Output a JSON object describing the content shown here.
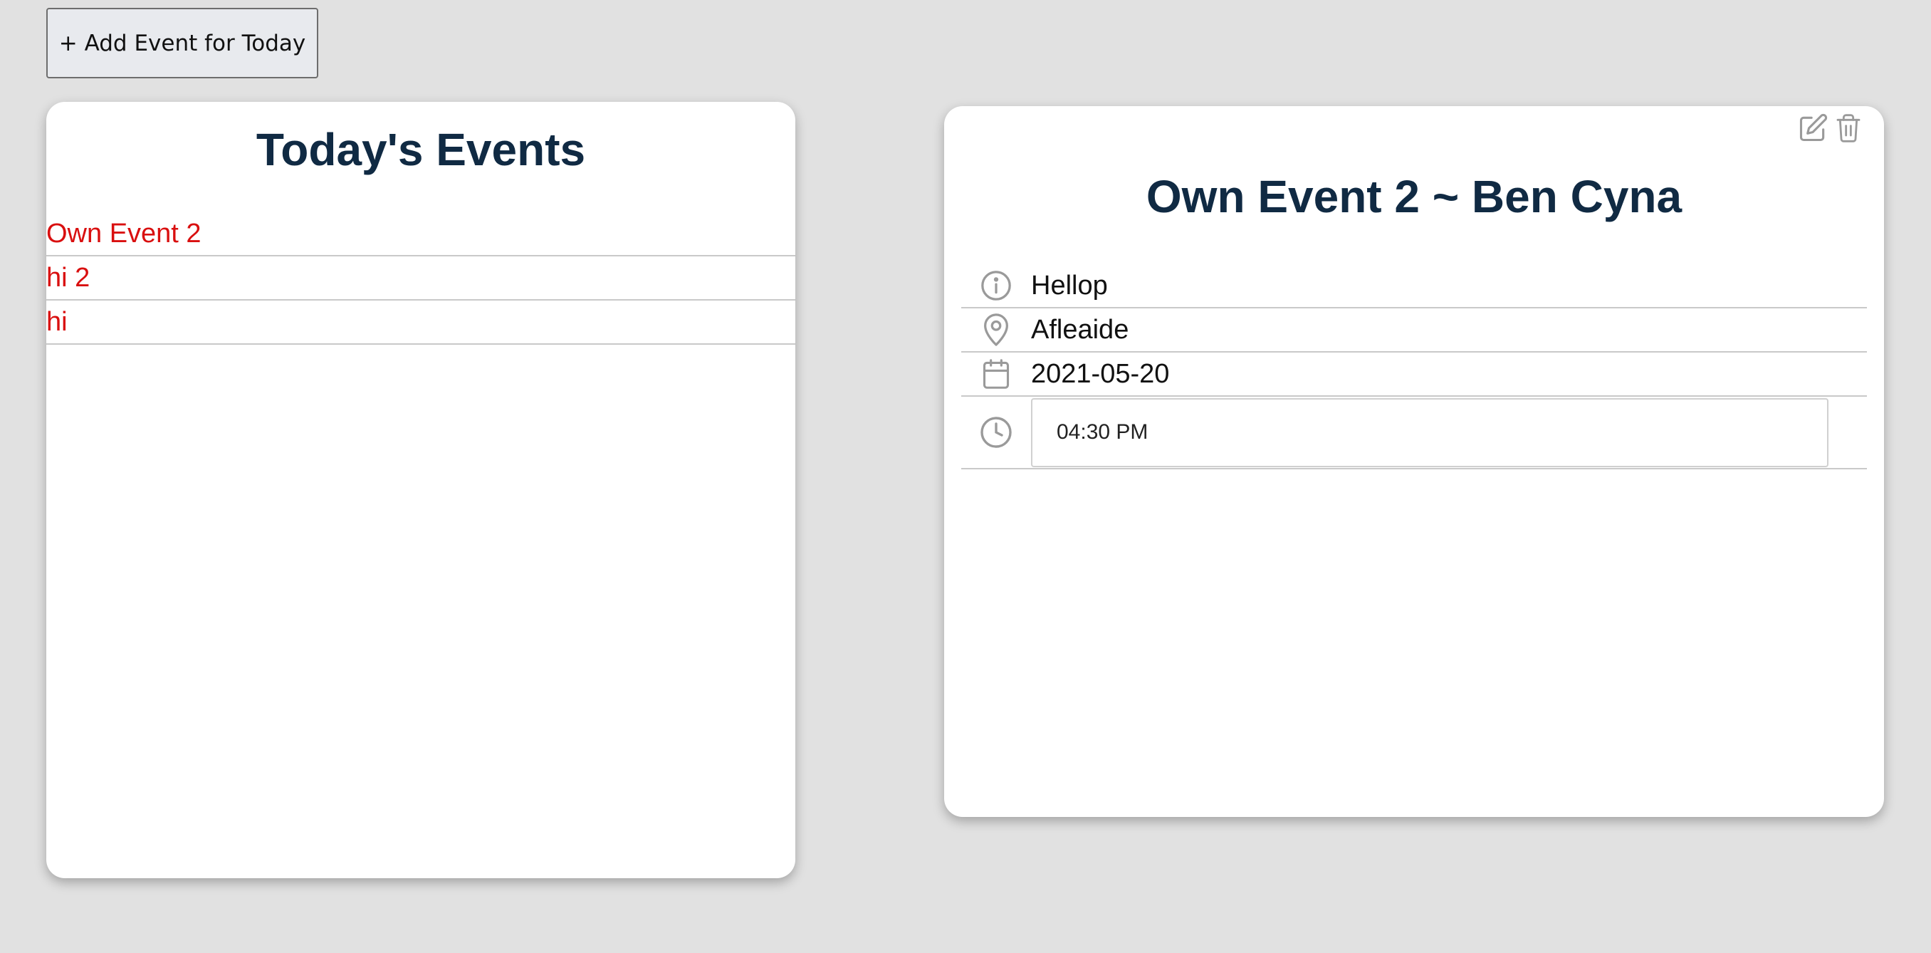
{
  "toolbar": {
    "add_event_label": "+ Add Event for Today"
  },
  "events_panel": {
    "title": "Today's Events",
    "items": [
      {
        "label": "Own Event 2"
      },
      {
        "label": "hi 2"
      },
      {
        "label": "hi"
      }
    ],
    "item_color": "#d90f0f"
  },
  "event_detail": {
    "title": "Own Event 2 ~ Ben Cyna",
    "description": "Hellop",
    "location": "Afleaide",
    "date": "2021-05-20",
    "time": "04:30 PM",
    "icons": {
      "edit": "edit-icon",
      "delete": "trash-icon",
      "description": "info-icon",
      "location": "location-pin-icon",
      "date": "calendar-icon",
      "time": "clock-icon"
    }
  },
  "colors": {
    "background": "#e1e1e1",
    "title": "#102a43",
    "icon": "#9a9a9a"
  }
}
